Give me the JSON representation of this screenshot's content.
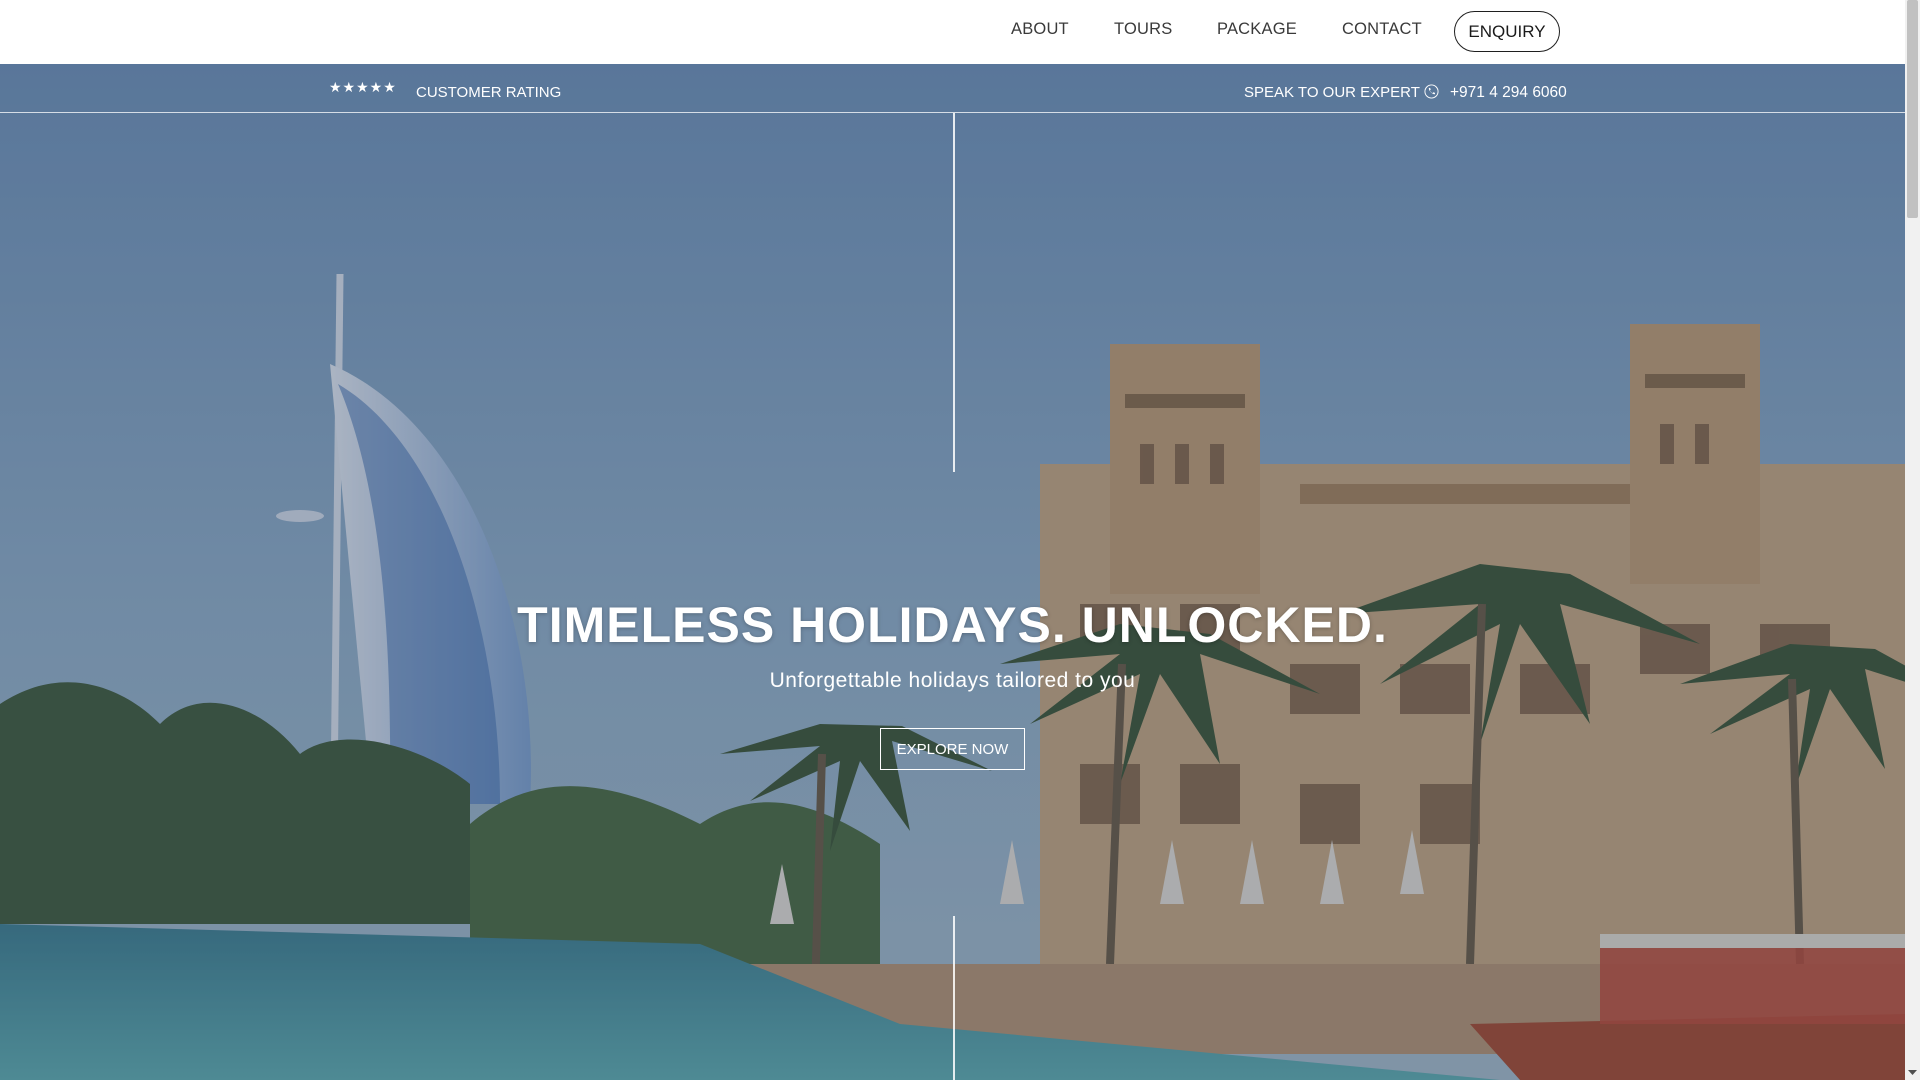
{
  "nav": {
    "items": [
      "ABOUT",
      "TOURS",
      "PACKAGE",
      "CONTACT"
    ],
    "enquiry_label": "ENQUIRY"
  },
  "info_bar": {
    "rating_icon": "star-icon",
    "rating_label": "CUSTOMER RATING",
    "expert_label": "SPEAK TO OUR EXPERT",
    "phone_icon": "phone-icon",
    "phone_number": "+971 4 294 6060"
  },
  "hero": {
    "headline": "TIMELESS HOLIDAYS. UNLOCKED.",
    "subline": "Unforgettable holidays tailored to you",
    "cta_label": "EXPLORE NOW"
  },
  "rating": {
    "stars": 5
  },
  "colors": {
    "overlay": "#2c3a5a",
    "sky": "#7aa0c0",
    "water": "#3f8a9a",
    "sand": "#c9a97e",
    "palm": "#3f5a36"
  }
}
